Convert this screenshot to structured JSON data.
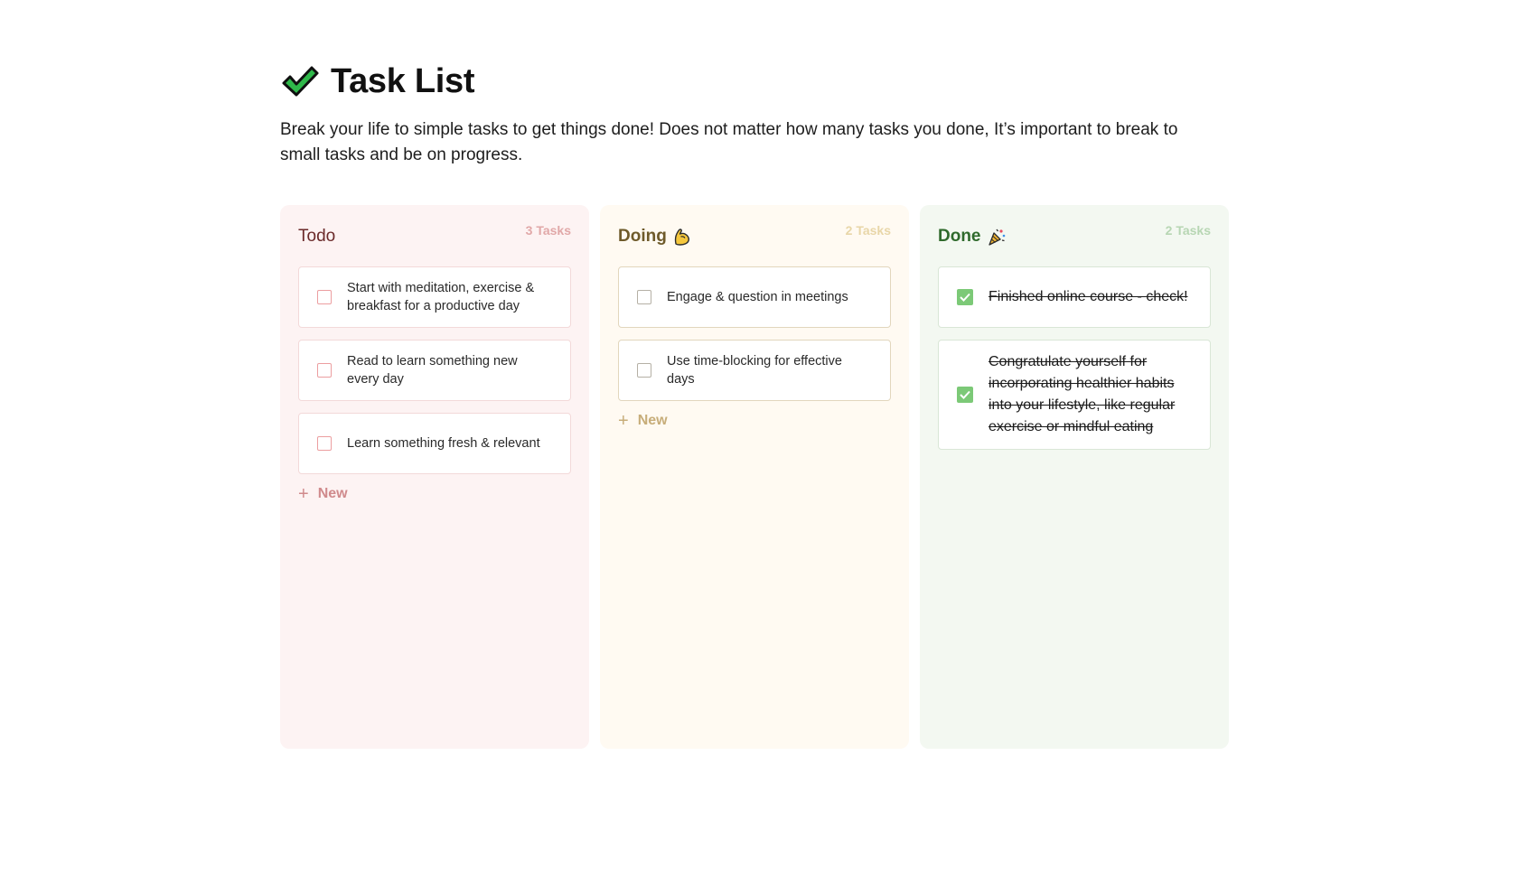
{
  "page": {
    "title": "Task List",
    "subtitle": "Break your life to simple tasks to get things done! Does not matter how many tasks you done, It’s important to break to small tasks and be on progress.",
    "title_icon": "check-mark-icon"
  },
  "columns": {
    "todo": {
      "title": "Todo",
      "count": "3 Tasks",
      "color": "#fdf3f3",
      "cards": [
        {
          "text": "Start with meditation, exercise & breakfast for a productive day",
          "checked": false
        },
        {
          "text": "Read to learn something new every day",
          "checked": false
        },
        {
          "text": "Learn something fresh & relevant",
          "checked": false
        }
      ],
      "new_label": "New"
    },
    "doing": {
      "title": "Doing",
      "emoji": "flexed-biceps-icon",
      "count": "2 Tasks",
      "color": "#fffaf2",
      "cards": [
        {
          "text": "Engage & question in meetings",
          "checked": false
        },
        {
          "text": "Use time-blocking for effective days",
          "checked": false
        }
      ],
      "new_label": "New"
    },
    "done": {
      "title": "Done",
      "emoji": "party-popper-icon",
      "count": "2 Tasks",
      "color": "#f3f8f1",
      "cards": [
        {
          "text": "Finished online course - check!",
          "checked": true
        },
        {
          "text": "Congratulate yourself for incorporating healthier habits into your lifestyle, like regular exercise or mindful eating",
          "checked": true
        }
      ]
    }
  }
}
